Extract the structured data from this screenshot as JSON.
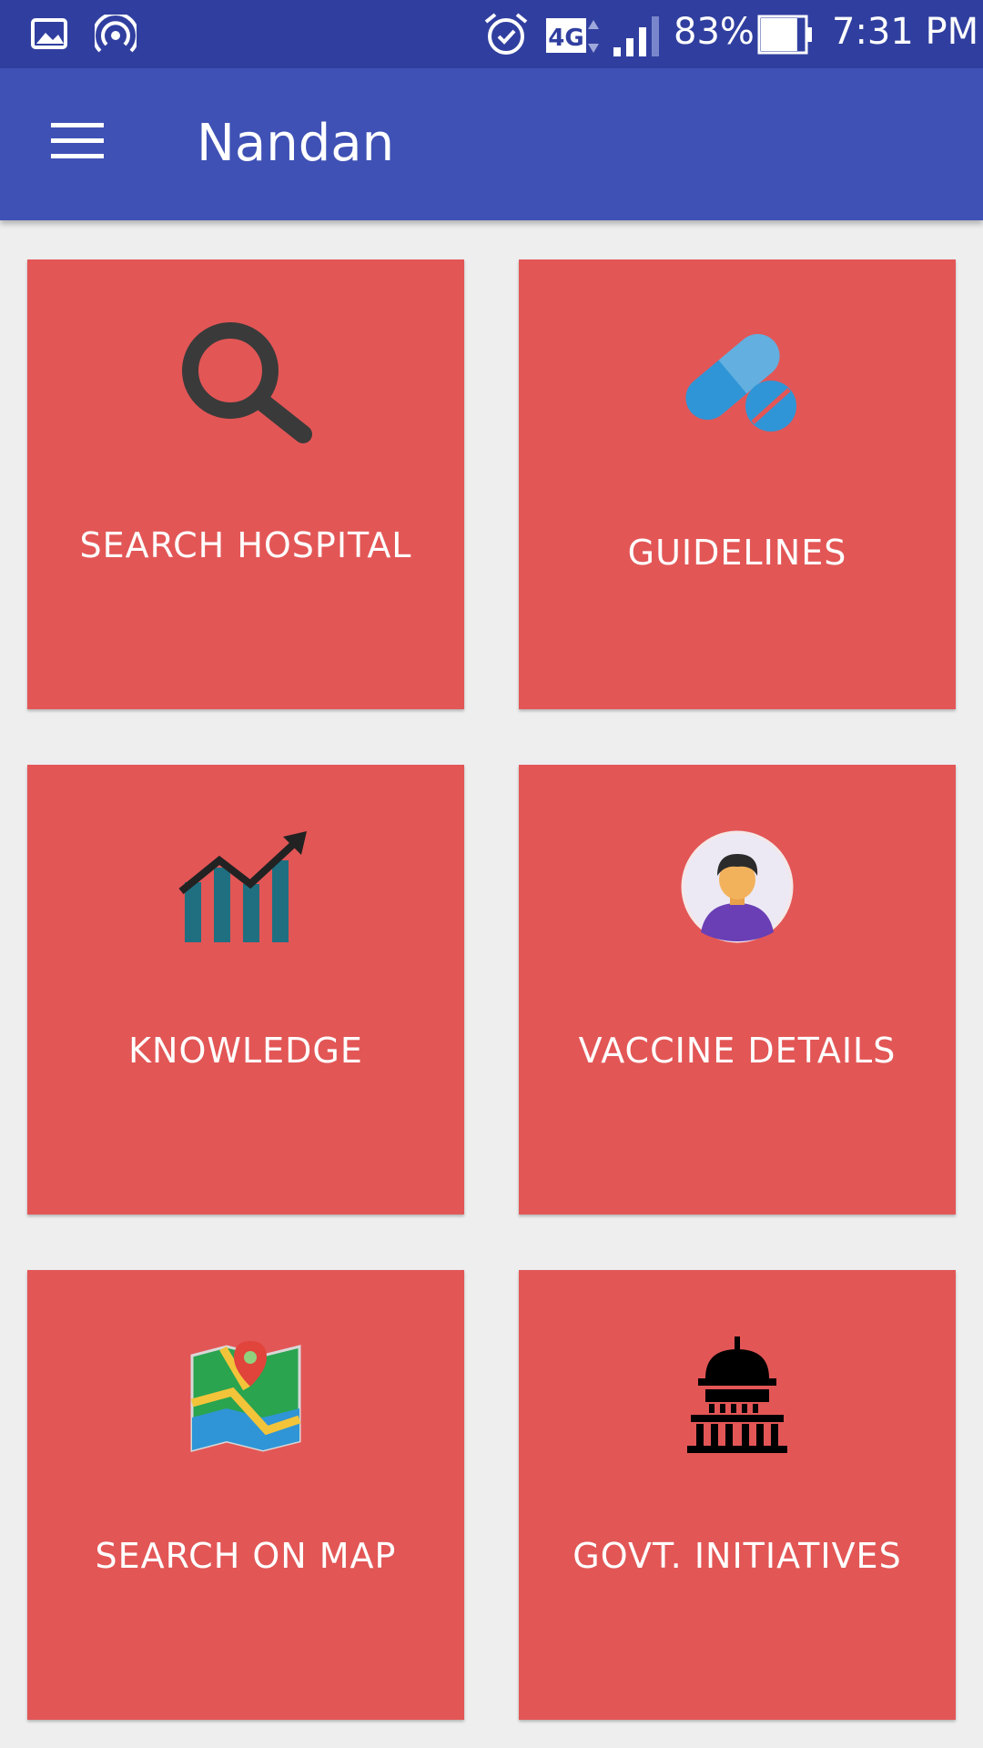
{
  "status_bar": {
    "icons": [
      "image-icon",
      "hotspot-icon",
      "alarm-icon",
      "network-4g-icon",
      "signal-icon",
      "battery-icon"
    ],
    "network": "4G",
    "battery": "83%",
    "battery_level": 0.83,
    "time": "7:31 PM"
  },
  "app_bar": {
    "menu_icon": "hamburger-menu-icon",
    "title": "Nandan"
  },
  "tiles": [
    {
      "label": "SEARCH HOSPITAL",
      "icon": "search-icon"
    },
    {
      "label": "GUIDELINES",
      "icon": "pills-icon"
    },
    {
      "label": "KNOWLEDGE",
      "icon": "growth-chart-icon"
    },
    {
      "label": "VACCINE DETAILS",
      "icon": "person-avatar-icon"
    },
    {
      "label": "SEARCH ON MAP",
      "icon": "map-pin-icon"
    },
    {
      "label": "GOVT. INITIATIVES",
      "icon": "government-building-icon"
    }
  ],
  "colors": {
    "status_bar": "#303f9f",
    "app_bar": "#3f51b5",
    "tile": "#e35656",
    "background": "#eeeeee"
  }
}
